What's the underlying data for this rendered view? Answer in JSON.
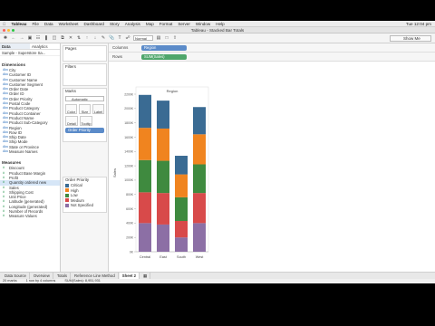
{
  "menubar": {
    "app": "Tableau",
    "items": [
      "File",
      "Data",
      "Worksheet",
      "Dashboard",
      "Story",
      "Analysis",
      "Map",
      "Format",
      "Server",
      "Window",
      "Help"
    ],
    "clock": "Tue 12:04 pm"
  },
  "window": {
    "title": "Tableau - Stacked Bar Totals"
  },
  "toolbar": {
    "fit_select": "Normal",
    "show_me": "Show Me"
  },
  "data_pane": {
    "tabs": [
      "Data",
      "Analytics"
    ],
    "datasource": "Sample - Superstore Sa...",
    "dimensions_header": "Dimensions",
    "dimensions": [
      "City",
      "Customer ID",
      "Customer Name",
      "Customer Segment",
      "Order Date",
      "Order ID",
      "Order Priority",
      "Postal Code",
      "Product Category",
      "Product Container",
      "Product Name",
      "Product Sub-Category",
      "Region",
      "Row ID",
      "Ship Date",
      "Ship Mode",
      "State or Province",
      "Measure Names"
    ],
    "measures_header": "Measures",
    "measures": [
      "Discount",
      "Product Base Margin",
      "Profit",
      "Quantity ordered new",
      "Sales",
      "Shipping Cost",
      "Unit Price",
      "Latitude (generated)",
      "Longitude (generated)",
      "Number of Records",
      "Measure Values"
    ]
  },
  "cards": {
    "pages": "Pages",
    "filters": "Filters",
    "marks": "Marks",
    "mark_type": "Automatic",
    "mark_buttons": [
      "Color",
      "Size",
      "Label",
      "Detail",
      "Tooltip"
    ],
    "color_pill": "Order Priority",
    "legend_title": "Order Priority",
    "legend": [
      "Critical",
      "High",
      "Low",
      "Medium",
      "Not Specified"
    ]
  },
  "shelves": {
    "columns_label": "Columns",
    "columns_pill": "Region",
    "rows_label": "Rows",
    "rows_pill": "SUM(Sales)"
  },
  "tabs": [
    "Data Source",
    "Overview",
    "Totals",
    "Reference Line Method",
    "Sheet 2"
  ],
  "status": [
    "20 marks",
    "1 row by 4 columns",
    "SUM(Sales): 8,951,931"
  ],
  "chart_data": {
    "type": "bar",
    "stacked": true,
    "header": "Region",
    "categories": [
      "Central",
      "East",
      "South",
      "West"
    ],
    "ylabel": "Sales",
    "ylim": [
      0,
      2200000
    ],
    "ticks": [
      "0K",
      "200K",
      "400K",
      "600K",
      "800K",
      "1000K",
      "1200K",
      "1400K",
      "1600K",
      "1800K",
      "2000K",
      "2200K"
    ],
    "series": [
      {
        "name": "Not Specified",
        "color": "#8c6fa5",
        "values": [
          400000,
          380000,
          200000,
          400000
        ]
      },
      {
        "name": "Medium",
        "color": "#d84a4a",
        "values": [
          430000,
          440000,
          230000,
          420000
        ]
      },
      {
        "name": "Low",
        "color": "#3f8a3f",
        "values": [
          450000,
          450000,
          330000,
          400000
        ]
      },
      {
        "name": "High",
        "color": "#f0841f",
        "values": [
          450000,
          450000,
          320000,
          420000
        ]
      },
      {
        "name": "Critical",
        "color": "#3a6b93",
        "values": [
          460000,
          390000,
          260000,
          380000
        ]
      }
    ],
    "grid": false,
    "legend": "left-card"
  }
}
